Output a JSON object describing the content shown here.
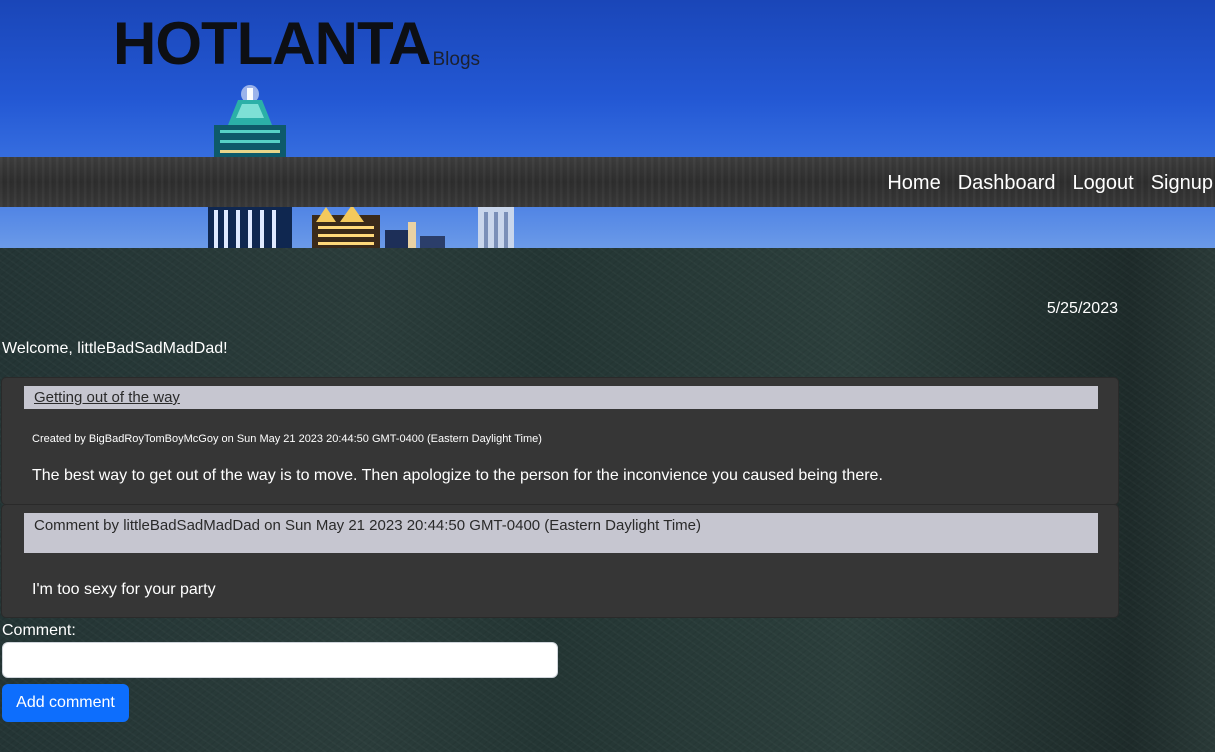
{
  "brand": {
    "title": "HOTLANTA",
    "subtitle": "Blogs"
  },
  "nav": {
    "items": [
      {
        "label": "Home"
      },
      {
        "label": "Dashboard"
      },
      {
        "label": "Logout"
      },
      {
        "label": "Signup"
      }
    ]
  },
  "main": {
    "date": "5/25/2023",
    "welcome": "Welcome, littleBadSadMadDad!"
  },
  "post": {
    "title": "Getting out of the way",
    "meta": "Created by BigBadRoyTomBoyMcGoy on Sun May 21 2023 20:44:50 GMT-0400 (Eastern Daylight Time)",
    "body": "The best way to get out of the way is to move. Then apologize to the person for the inconvience you caused being there."
  },
  "comment": {
    "header": "Comment by littleBadSadMadDad on Sun May 21 2023 20:44:50 GMT-0400 (Eastern Daylight Time)",
    "body": "I'm too sexy for your party"
  },
  "form": {
    "label": "Comment:",
    "input_value": "",
    "button_label": "Add comment"
  },
  "colors": {
    "accent_button": "#0d6efd",
    "card_bg": "#363636",
    "title_bar_bg": "#c6c6d0",
    "navbar_bg": "#333333"
  }
}
